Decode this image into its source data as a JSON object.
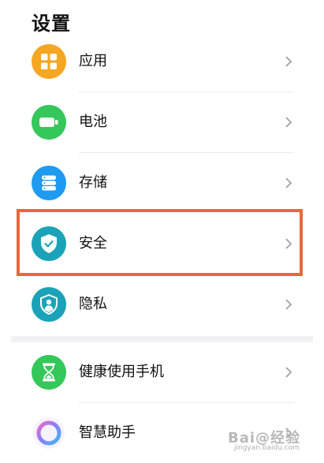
{
  "header": {
    "title": "设置"
  },
  "items": [
    {
      "label": "应用",
      "icon": "apps-grid-icon",
      "color": "#F5A623"
    },
    {
      "label": "电池",
      "icon": "battery-icon",
      "color": "#34C759"
    },
    {
      "label": "存储",
      "icon": "storage-icon",
      "color": "#1E9BF0"
    },
    {
      "label": "安全",
      "icon": "shield-check-icon",
      "color": "#1AA3B8"
    },
    {
      "label": "隐私",
      "icon": "privacy-person-shield-icon",
      "color": "#1AA3B8"
    },
    {
      "label": "健康使用手机",
      "icon": "hourglass-icon",
      "color": "#34C759"
    },
    {
      "label": "智慧助手",
      "icon": "smart-assistant-ring-icon",
      "color": "#8E7CF5"
    }
  ],
  "highlight": {
    "target": "安全",
    "color": "#E8673C"
  },
  "watermark": {
    "text": "Bai@经验",
    "sub": "jingyan.baidu.com"
  }
}
